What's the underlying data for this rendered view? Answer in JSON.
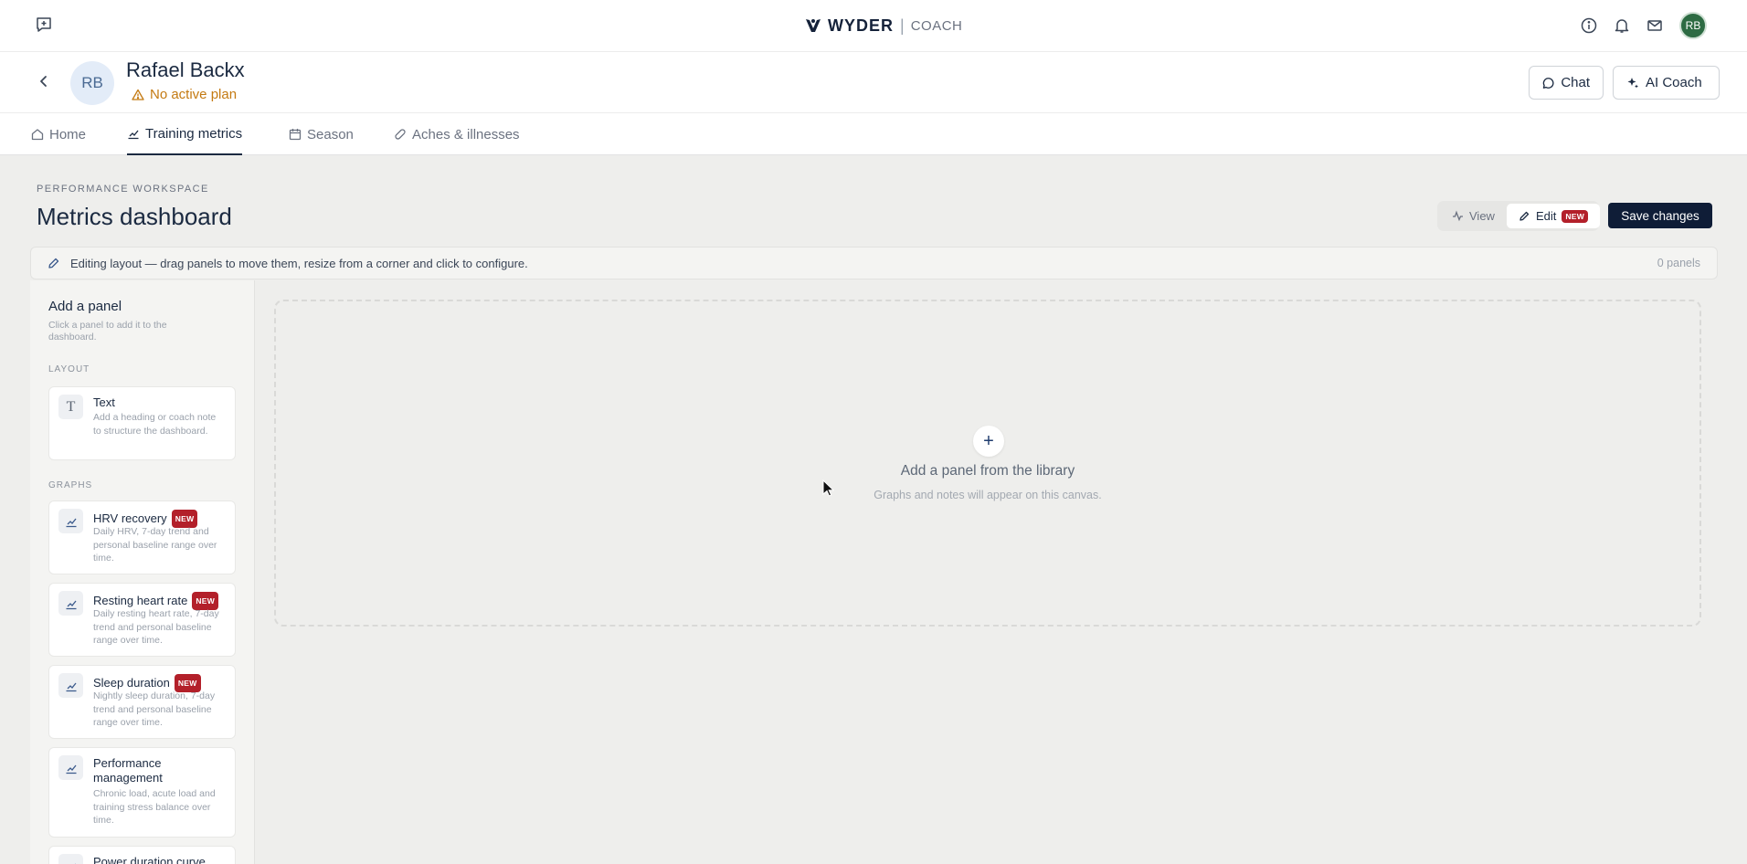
{
  "app": {
    "brand_name": "WYDER",
    "brand_sub": "COACH",
    "user_initials": "RB",
    "accent_color": "#0f1d37",
    "avatar_color": "#2d6b43",
    "new_badge_color": "#b3202a",
    "warning_color": "#c47a12"
  },
  "athlete": {
    "initials": "RB",
    "name": "Rafael Backx",
    "plan_status": "No active plan",
    "chat_label": "Chat",
    "ai_coach_label": "AI Coach"
  },
  "tabs": [
    {
      "label": "Home",
      "icon": "home-icon",
      "active": false
    },
    {
      "label": "Training metrics",
      "icon": "chart-icon",
      "active": true
    },
    {
      "label": "Season",
      "icon": "calendar-icon",
      "active": false
    },
    {
      "label": "Aches & illnesses",
      "icon": "bandage-icon",
      "active": false
    }
  ],
  "page": {
    "eyebrow": "PERFORMANCE WORKSPACE",
    "title": "Metrics dashboard",
    "view_label": "View",
    "edit_label": "Edit",
    "new_badge": "NEW",
    "save_label": "Save changes",
    "mode": "Edit"
  },
  "edit_bar": {
    "text": "Editing layout — drag panels to move them, resize from a corner and click to configure.",
    "panel_count": "0 panels"
  },
  "library": {
    "title": "Add a panel",
    "subtitle": "Click a panel to add it to the dashboard.",
    "layout_heading": "LAYOUT",
    "graphs_heading": "GRAPHS",
    "layout_items": [
      {
        "title": "Text",
        "desc": "Add a heading or coach note to structure the dashboard.",
        "icon": "text-icon"
      }
    ],
    "graph_items": [
      {
        "title": "HRV recovery",
        "badge": "NEW",
        "desc": "Daily HRV, 7-day trend and personal baseline range over time.",
        "icon": "chart-icon"
      },
      {
        "title": "Resting heart rate",
        "badge": "NEW",
        "desc": "Daily resting heart rate, 7-day trend and personal baseline range over time.",
        "icon": "chart-icon"
      },
      {
        "title": "Sleep duration",
        "badge": "NEW",
        "desc": "Nightly sleep duration, 7-day trend and personal baseline range over time.",
        "icon": "chart-icon"
      },
      {
        "title": "Performance management",
        "badge": "",
        "desc": "Chronic load, acute load and training stress balance over time.",
        "icon": "chart-icon"
      },
      {
        "title": "Power duration curve",
        "badge": "",
        "desc": "",
        "icon": "chart-icon"
      }
    ]
  },
  "canvas": {
    "plus": "+",
    "title": "Add a panel from the library",
    "subtitle": "Graphs and notes will appear on this canvas."
  }
}
